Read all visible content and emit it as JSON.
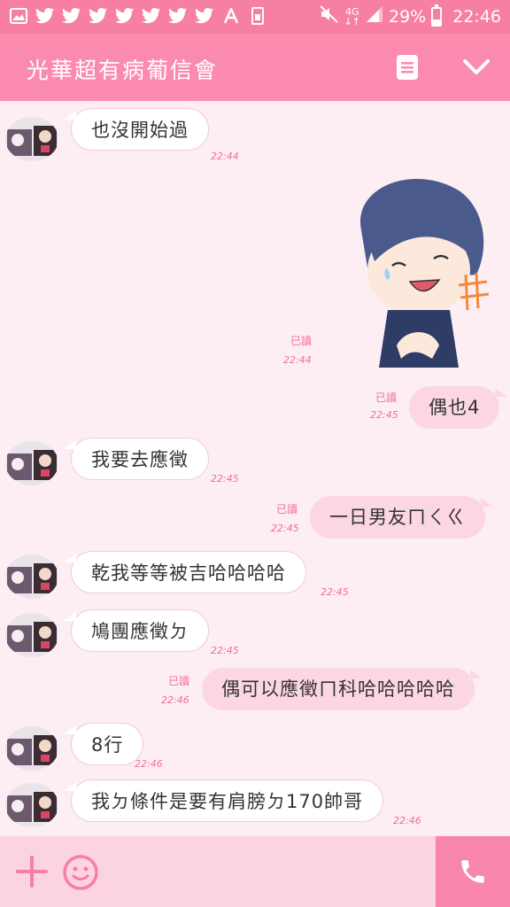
{
  "status_bar": {
    "network": "4G",
    "battery_percent": "29%",
    "battery_level": 0.29,
    "time": "22:46",
    "left_icons": [
      "image-icon",
      "twitter-icon",
      "twitter-icon",
      "twitter-icon",
      "twitter-icon",
      "twitter-icon",
      "twitter-icon",
      "twitter-icon",
      "app-icon",
      "sim-icon"
    ]
  },
  "header": {
    "title": "光華超有病葡信會",
    "menu_icon": "note-icon",
    "collapse_icon": "chevron-down-icon"
  },
  "messages": [
    {
      "side": "in",
      "text": "也沒開始過",
      "time": "22:44"
    },
    {
      "side": "out",
      "type": "sticker",
      "read": "已讀",
      "time": "22:44"
    },
    {
      "side": "out",
      "text": "偶也4",
      "read": "已讀",
      "time": "22:45"
    },
    {
      "side": "in",
      "text": "我要去應徵",
      "time": "22:45"
    },
    {
      "side": "out",
      "text": "一日男友ㄇㄑㄍ",
      "read": "已讀",
      "time": "22:45"
    },
    {
      "side": "in",
      "text": "乾我等等被吉哈哈哈哈",
      "time": "22:45"
    },
    {
      "side": "in",
      "text": "鳩團應徵ㄉ",
      "time": "22:45"
    },
    {
      "side": "out",
      "text": "偶可以應徵ㄇ科哈哈哈哈哈",
      "read": "已讀",
      "time": "22:46"
    },
    {
      "side": "in",
      "text": "8行",
      "time": "22:46"
    },
    {
      "side": "in",
      "text": "我ㄉ條件是要有肩膀ㄉ170帥哥",
      "time": "22:46"
    }
  ],
  "input_bar": {
    "add_icon": "plus-icon",
    "emoji_icon": "smiley-icon",
    "call_icon": "phone-icon"
  },
  "colors": {
    "status_bar": "#f77fa2",
    "header": "#fb8bae",
    "background": "#fdeef3",
    "outgoing_bubble": "#fcd7e3",
    "accent": "#f07096"
  }
}
